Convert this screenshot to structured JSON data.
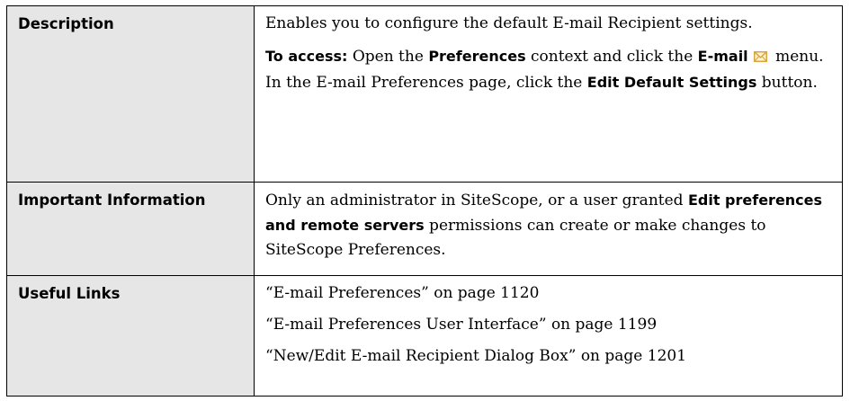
{
  "rows": [
    {
      "label": "Description",
      "description_text": "Enables you to configure the default E-mail Recipient settings.",
      "access": {
        "intro": "To access:",
        "part1": " Open the ",
        "context_name": "Preferences",
        "part2": " context and click the ",
        "menu_name": "E-mail",
        "part3": " menu. In the E-mail Preferences page, click the ",
        "button_name": "Edit Default Settings",
        "part4": " button."
      }
    },
    {
      "label": "Important Information",
      "text1": "Only an administrator in SiteScope, or a user granted ",
      "emphasis": "Edit preferences and remote servers",
      "text2": " permissions can create or make changes to SiteScope Preferences."
    },
    {
      "label": "Useful Links",
      "links": [
        "“E-mail Preferences” on page 1120",
        "“E-mail Preferences User Interface” on page 1199",
        "“New/Edit E-mail Recipient Dialog Box” on page 1201"
      ]
    }
  ],
  "icons": {
    "email": "envelope-icon",
    "color": "#d9a441"
  }
}
